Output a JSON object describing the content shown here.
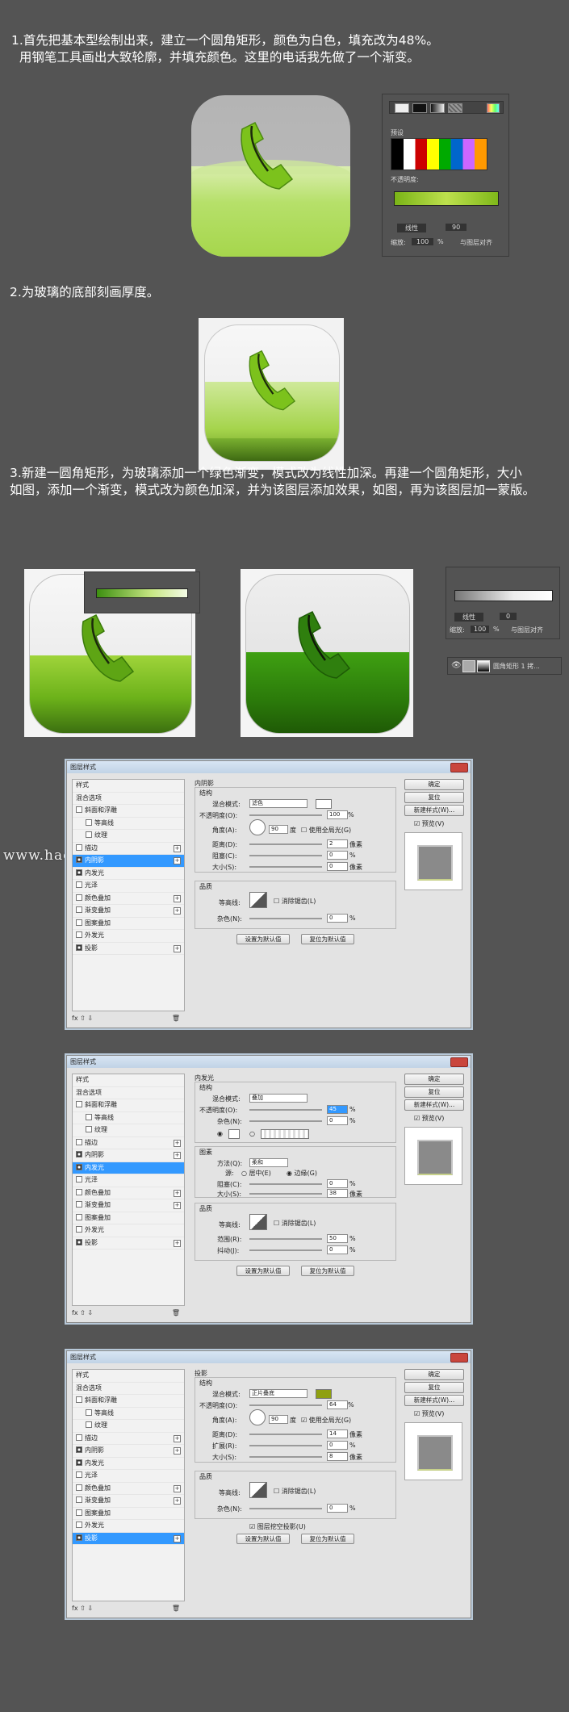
{
  "steps": [
    {
      "text": "1.首先把基本型绘制出来，建立一个圆角矩形，颜色为白色，填充改为48%。\n  用钢笔工具画出大致轮廓，并填充颜色。这里的电话我先做了一个渐变。"
    },
    {
      "text": "2.为玻璃的底部刻画厚度。"
    },
    {
      "text": "3.新建一圆角矩形，为玻璃添加一个绿色渐变，模式改为线性加深。再建一个圆角矩形，大小\n如图，添加一个渐变，模式改为颜色加深，并为该图层添加效果，如图，再为该图层加一蒙版。"
    }
  ],
  "gradient_panel": {
    "presets_label": "预设",
    "opacity_label": "不透明度:",
    "mode_value": "线性",
    "angle_value": "90",
    "scale_label": "缩放:",
    "scale_value": "100",
    "percent": "%",
    "align_label": "与图层对齐"
  },
  "gradient_panel2": {
    "mode_value": "线性",
    "angle_value": "0",
    "scale_label": "缩放:",
    "scale_value": "100",
    "percent": "%",
    "align_label": "与图层对齐"
  },
  "layers_panel": {
    "layer_name": "圆角矩形 1 拷..."
  },
  "watermark": "www.haoxiaoshejimianshe...com",
  "dialogs": [
    {
      "title": "图层样式",
      "list": [
        {
          "label": "样式",
          "type": "header"
        },
        {
          "label": "混合选项",
          "type": "header"
        },
        {
          "label": "斜面和浮雕",
          "type": "check"
        },
        {
          "label": "等高线",
          "type": "indent"
        },
        {
          "label": "纹理",
          "type": "indent"
        },
        {
          "label": "描边",
          "type": "check",
          "plus": true
        },
        {
          "label": "内阴影",
          "type": "check",
          "checked": true,
          "selected": true,
          "plus": true
        },
        {
          "label": "内发光",
          "type": "check",
          "checked": true
        },
        {
          "label": "光泽",
          "type": "check"
        },
        {
          "label": "颜色叠加",
          "type": "check",
          "plus": true
        },
        {
          "label": "渐变叠加",
          "type": "check",
          "plus": true
        },
        {
          "label": "图案叠加",
          "type": "check"
        },
        {
          "label": "外发光",
          "type": "check"
        },
        {
          "label": "投影",
          "type": "check",
          "checked": true,
          "plus": true
        }
      ],
      "section": "内阴影",
      "structure": "结构",
      "blend_label": "混合模式:",
      "blend_value": "滤色",
      "opacity_label": "不透明度(O):",
      "opacity_value": "100",
      "angle_label": "角度(A):",
      "angle_value": "90",
      "angle_unit": "度",
      "global_light": "使用全局光(G)",
      "distance_label": "距离(D):",
      "distance_value": "2",
      "choke_label": "阻塞(C):",
      "choke_value": "0",
      "size_label": "大小(S):",
      "size_value": "0",
      "px": "像素",
      "quality": "品质",
      "contour_label": "等高线:",
      "antialias": "消除锯齿(L)",
      "noise_label": "杂色(N):",
      "noise_value": "0",
      "btn_default": "设置为默认值",
      "btn_reset": "复位为默认值",
      "ok": "确定",
      "reset": "复位",
      "new_style": "新建样式(W)...",
      "preview": "预览(V)"
    },
    {
      "title": "图层样式",
      "list": [
        {
          "label": "样式",
          "type": "header"
        },
        {
          "label": "混合选项",
          "type": "header"
        },
        {
          "label": "斜面和浮雕",
          "type": "check"
        },
        {
          "label": "等高线",
          "type": "indent"
        },
        {
          "label": "纹理",
          "type": "indent"
        },
        {
          "label": "描边",
          "type": "check",
          "plus": true
        },
        {
          "label": "内阴影",
          "type": "check",
          "checked": true,
          "plus": true
        },
        {
          "label": "内发光",
          "type": "check",
          "checked": true,
          "selected": true
        },
        {
          "label": "光泽",
          "type": "check"
        },
        {
          "label": "颜色叠加",
          "type": "check",
          "plus": true
        },
        {
          "label": "渐变叠加",
          "type": "check",
          "plus": true
        },
        {
          "label": "图案叠加",
          "type": "check"
        },
        {
          "label": "外发光",
          "type": "check"
        },
        {
          "label": "投影",
          "type": "check",
          "checked": true,
          "plus": true
        }
      ],
      "section": "内发光",
      "structure": "结构",
      "blend_label": "混合模式:",
      "blend_value": "叠加",
      "opacity_label": "不透明度(O):",
      "opacity_value": "45",
      "noise_label": "杂色(N):",
      "noise_value": "0",
      "elements": "图素",
      "method_label": "方法(Q):",
      "method_value": "柔和",
      "source_label": "源:",
      "center": "居中(E)",
      "edge": "边缘(G)",
      "choke_label": "阻塞(C):",
      "choke_value": "0",
      "size_label": "大小(S):",
      "size_value": "38",
      "px": "像素",
      "quality": "品质",
      "contour_label": "等高线:",
      "antialias": "消除锯齿(L)",
      "range_label": "范围(R):",
      "range_value": "50",
      "jitter_label": "抖动(J):",
      "jitter_value": "0",
      "btn_default": "设置为默认值",
      "btn_reset": "复位为默认值",
      "ok": "确定",
      "reset": "复位",
      "new_style": "新建样式(W)...",
      "preview": "预览(V)"
    },
    {
      "title": "图层样式",
      "list": [
        {
          "label": "样式",
          "type": "header"
        },
        {
          "label": "混合选项",
          "type": "header"
        },
        {
          "label": "斜面和浮雕",
          "type": "check"
        },
        {
          "label": "等高线",
          "type": "indent"
        },
        {
          "label": "纹理",
          "type": "indent"
        },
        {
          "label": "描边",
          "type": "check",
          "plus": true
        },
        {
          "label": "内阴影",
          "type": "check",
          "checked": true,
          "plus": true
        },
        {
          "label": "内发光",
          "type": "check",
          "checked": true
        },
        {
          "label": "光泽",
          "type": "check"
        },
        {
          "label": "颜色叠加",
          "type": "check",
          "plus": true
        },
        {
          "label": "渐变叠加",
          "type": "check",
          "plus": true
        },
        {
          "label": "图案叠加",
          "type": "check"
        },
        {
          "label": "外发光",
          "type": "check"
        },
        {
          "label": "投影",
          "type": "check",
          "checked": true,
          "selected": true,
          "plus": true
        }
      ],
      "section": "投影",
      "structure": "结构",
      "blend_label": "混合模式:",
      "blend_value": "正片叠底",
      "color": "#8fa010",
      "opacity_label": "不透明度(O):",
      "opacity_value": "64",
      "angle_label": "角度(A):",
      "angle_value": "90",
      "angle_unit": "度",
      "global_light": "使用全局光(G)",
      "distance_label": "距离(D):",
      "distance_value": "14",
      "spread_label": "扩展(R):",
      "spread_value": "0",
      "size_label": "大小(S):",
      "size_value": "8",
      "px": "像素",
      "quality": "品质",
      "contour_label": "等高线:",
      "antialias": "消除锯齿(L)",
      "noise_label": "杂色(N):",
      "noise_value": "0",
      "knockout": "图层挖空投影(U)",
      "btn_default": "设置为默认值",
      "btn_reset": "复位为默认值",
      "ok": "确定",
      "reset": "复位",
      "new_style": "新建样式(W)...",
      "preview": "预览(V)"
    }
  ]
}
